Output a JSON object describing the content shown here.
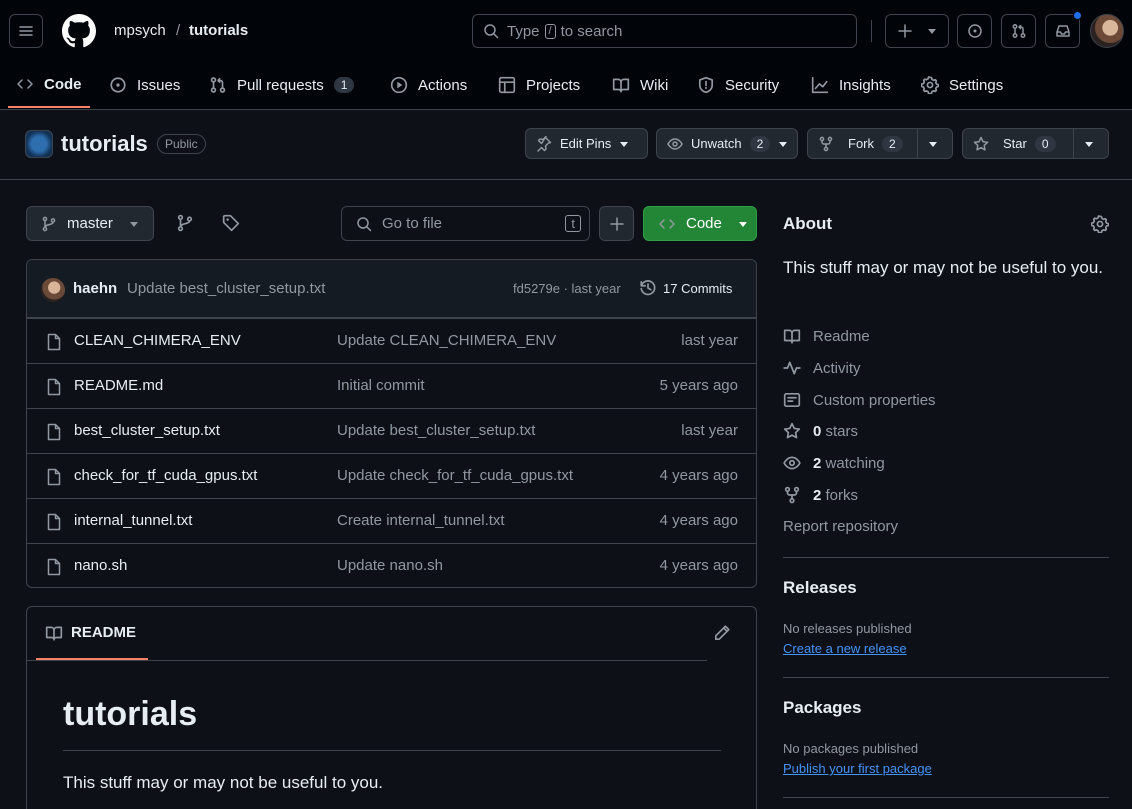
{
  "header": {
    "owner": "mpsych",
    "separator": "/",
    "repo": "tutorials",
    "search_prefix": "Type",
    "search_key": "/",
    "search_suffix": "to search"
  },
  "nav_tabs": [
    {
      "label": "Code",
      "icon": "code-icon",
      "selected": true
    },
    {
      "label": "Issues",
      "icon": "issue-icon"
    },
    {
      "label": "Pull requests",
      "icon": "pull-request-icon",
      "count": "1"
    },
    {
      "label": "Actions",
      "icon": "play-icon"
    },
    {
      "label": "Projects",
      "icon": "table-icon"
    },
    {
      "label": "Wiki",
      "icon": "book-icon"
    },
    {
      "label": "Security",
      "icon": "shield-icon"
    },
    {
      "label": "Insights",
      "icon": "graph-icon"
    },
    {
      "label": "Settings",
      "icon": "gear-icon"
    }
  ],
  "repo_header": {
    "name": "tutorials",
    "visibility": "Public",
    "edit_pins": "Edit Pins",
    "unwatch": "Unwatch",
    "watch_count": "2",
    "fork": "Fork",
    "fork_count": "2",
    "star": "Star",
    "star_count": "0"
  },
  "toolbar": {
    "branch": "master",
    "goto_placeholder": "Go to file",
    "goto_key": "t",
    "code_button": "Code"
  },
  "latest_commit": {
    "author": "haehn",
    "message": "Update best_cluster_setup.txt",
    "hash_time": "fd5279e · last year",
    "commits": "17 Commits"
  },
  "files": [
    {
      "name": "CLEAN_CHIMERA_ENV",
      "message": "Update CLEAN_CHIMERA_ENV",
      "time": "last year"
    },
    {
      "name": "README.md",
      "message": "Initial commit",
      "time": "5 years ago"
    },
    {
      "name": "best_cluster_setup.txt",
      "message": "Update best_cluster_setup.txt",
      "time": "last year"
    },
    {
      "name": "check_for_tf_cuda_gpus.txt",
      "message": "Update check_for_tf_cuda_gpus.txt",
      "time": "4 years ago"
    },
    {
      "name": "internal_tunnel.txt",
      "message": "Create internal_tunnel.txt",
      "time": "4 years ago"
    },
    {
      "name": "nano.sh",
      "message": "Update nano.sh",
      "time": "4 years ago"
    }
  ],
  "readme": {
    "tab_label": "README",
    "heading": "tutorials",
    "body": "This stuff may or may not be useful to you."
  },
  "about": {
    "title": "About",
    "description": "This stuff may or may not be useful to you.",
    "readme": "Readme",
    "activity": "Activity",
    "custom_properties": "Custom properties",
    "stars_count": "0",
    "stars_label": "stars",
    "watching_count": "2",
    "watching_label": "watching",
    "forks_count": "2",
    "forks_label": "forks",
    "report": "Report repository"
  },
  "releases": {
    "title": "Releases",
    "empty": "No releases published",
    "create_link": "Create a new release"
  },
  "packages": {
    "title": "Packages",
    "empty": "No packages published",
    "publish_link": "Publish your first package"
  },
  "colors": {
    "background": "#0d1117",
    "header": "#010409",
    "border": "#3d444d",
    "accent_green": "#238636",
    "tab_underline": "#f78166",
    "link": "#4493f8",
    "notification_dot": "#1f6feb"
  }
}
